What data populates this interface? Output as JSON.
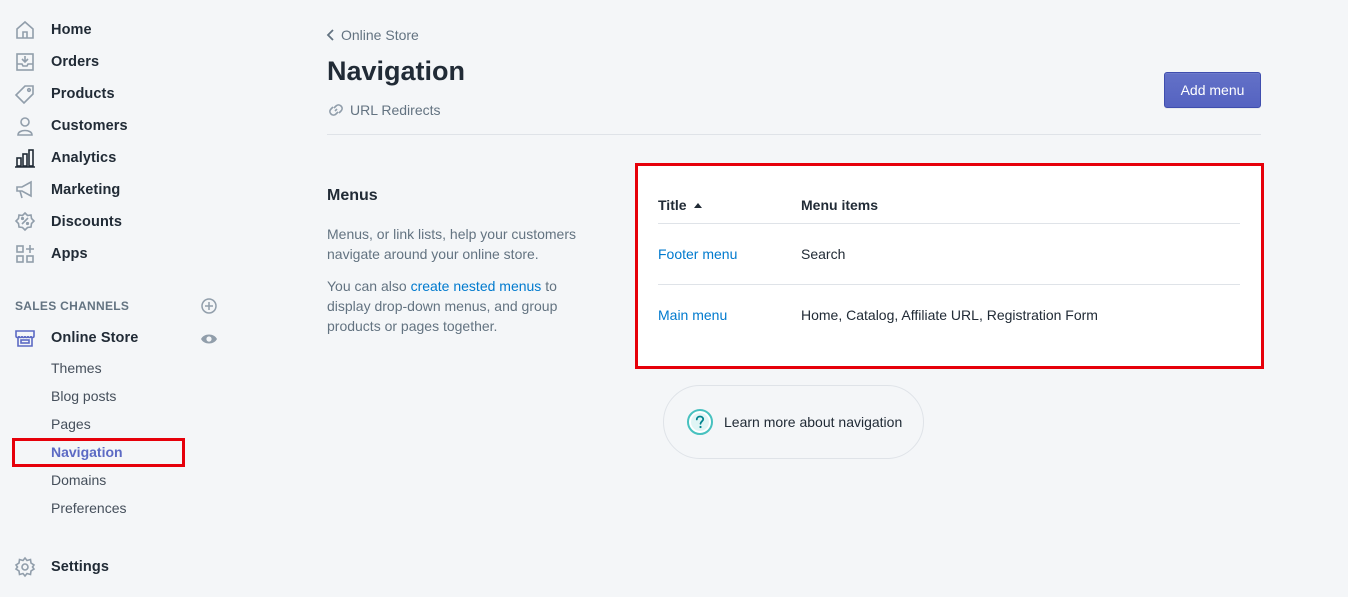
{
  "sidebar": {
    "items": [
      {
        "label": "Home",
        "icon": "home-icon"
      },
      {
        "label": "Orders",
        "icon": "orders-icon"
      },
      {
        "label": "Products",
        "icon": "tag-icon"
      },
      {
        "label": "Customers",
        "icon": "person-icon"
      },
      {
        "label": "Analytics",
        "icon": "bar-chart-icon"
      },
      {
        "label": "Marketing",
        "icon": "megaphone-icon"
      },
      {
        "label": "Discounts",
        "icon": "discount-icon"
      },
      {
        "label": "Apps",
        "icon": "apps-icon"
      }
    ],
    "sales_channels_title": "SALES CHANNELS",
    "online_store": "Online Store",
    "sub_items": [
      "Themes",
      "Blog posts",
      "Pages",
      "Navigation",
      "Domains",
      "Preferences"
    ],
    "active_sub_item": "Navigation",
    "settings": "Settings"
  },
  "header": {
    "breadcrumb": "Online Store",
    "title": "Navigation",
    "url_redirects": "URL Redirects",
    "add_menu": "Add menu"
  },
  "menus_section": {
    "heading": "Menus",
    "description": "Menus, or link lists, help your customers navigate around your online store.",
    "desc2_prefix": "You can also ",
    "desc2_link": "create nested menus",
    "desc2_suffix": " to display drop-down menus, and group products or pages together."
  },
  "table": {
    "columns": [
      "Title",
      "Menu items"
    ],
    "rows": [
      {
        "title": "Footer menu",
        "items": "Search"
      },
      {
        "title": "Main menu",
        "items": "Home, Catalog, Affiliate URL, Registration Form"
      }
    ]
  },
  "learn_more": {
    "prefix": "Learn more about ",
    "link": "navigation"
  },
  "colors": {
    "accent": "#5c6ac4",
    "link": "#007ace",
    "highlight": "#e6000a"
  }
}
